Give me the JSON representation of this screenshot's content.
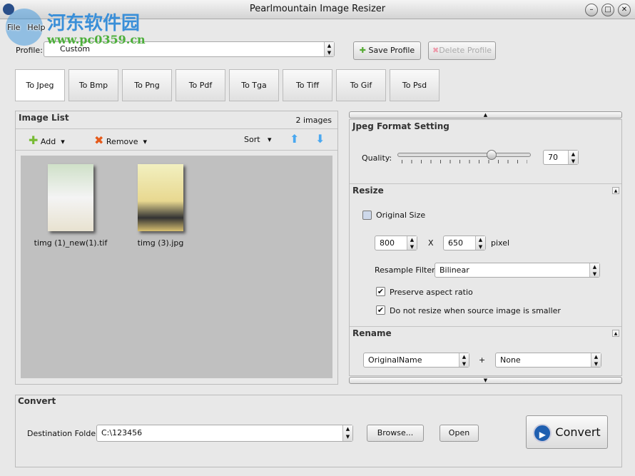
{
  "window": {
    "title": "Pearlmountain Image Resizer",
    "watermark_cn": "河东软件园",
    "watermark_url": "www.pc0359.cn"
  },
  "menu": [
    "File",
    "Help"
  ],
  "profile": {
    "label": "Profile:",
    "value": "Custom",
    "save": "Save Profile",
    "delete": "Delete Profile"
  },
  "tabs": [
    "To Jpeg",
    "To Bmp",
    "To Png",
    "To Pdf",
    "To Tga",
    "To Tiff",
    "To Gif",
    "To Psd"
  ],
  "image_list": {
    "title": "Image List",
    "count": "2 images",
    "add": "Add",
    "remove": "Remove",
    "sort": "Sort",
    "items": [
      {
        "name": "timg (1)_new(1).tif"
      },
      {
        "name": "timg (3).jpg"
      }
    ]
  },
  "jpeg": {
    "title": "Jpeg Format Setting",
    "quality_label": "Quality:",
    "quality": "70",
    "quality_percent": 70
  },
  "resize": {
    "title": "Resize",
    "original_size": "Original Size",
    "original_checked": false,
    "width": "800",
    "x": "X",
    "height": "650",
    "unit": "pixel",
    "filter_label": "Resample Filter:",
    "filter": "Bilinear",
    "preserve": "Preserve aspect ratio",
    "no_upscale": "Do not resize when source image is smaller"
  },
  "rename": {
    "title": "Rename",
    "left": "OriginalName",
    "plus": "+",
    "right": "None"
  },
  "convert": {
    "title": "Convert",
    "dest_label": "Destination Folder:",
    "dest": "C:\\123456",
    "browse": "Browse...",
    "open": "Open",
    "convert": "Convert"
  }
}
